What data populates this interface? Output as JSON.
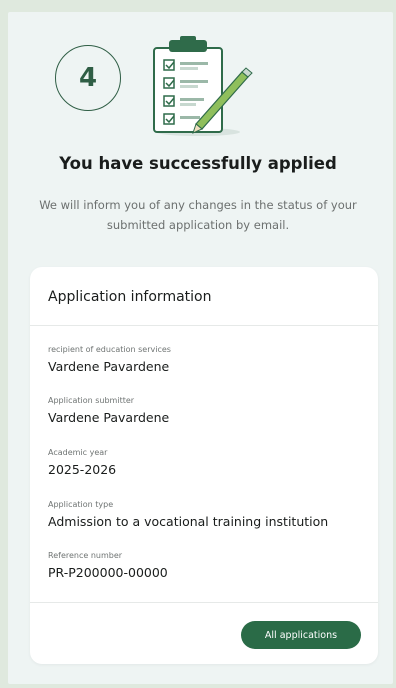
{
  "step": {
    "number": "4"
  },
  "header": {
    "title": "You have successfully applied",
    "subtitle": "We will inform you of any changes in the status of your submitted application by email."
  },
  "card": {
    "title": "Application information",
    "fields": [
      {
        "label": "recipient of education services",
        "value": "Vardene Pavardene"
      },
      {
        "label": "Application submitter",
        "value": "Vardene Pavardene"
      },
      {
        "label": "Academic year",
        "value": "2025-2026"
      },
      {
        "label": "Application type",
        "value": "Admission to a vocational training institution"
      },
      {
        "label": "Reference number",
        "value": "PR-P200000-00000"
      }
    ],
    "all_applications_label": "All applications"
  },
  "colors": {
    "accent": "#2a6b47",
    "background": "#eef4f3",
    "outer_background": "#dfe9de"
  },
  "icons": {
    "illustration": "clipboard-checklist-icon"
  }
}
